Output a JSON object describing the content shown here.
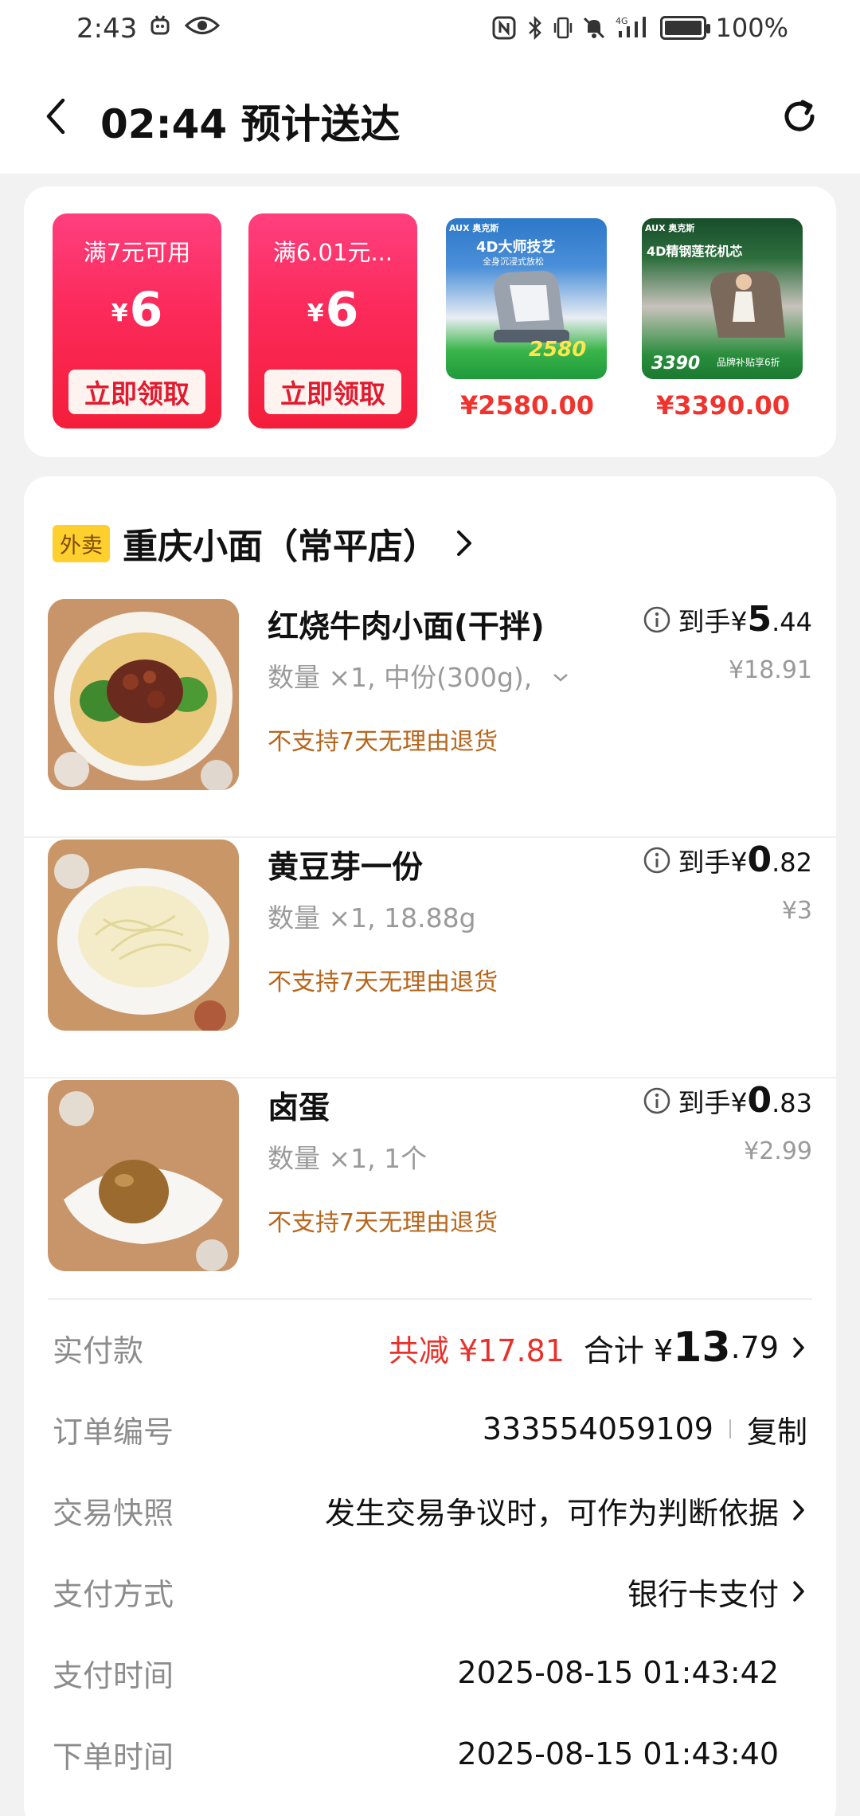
{
  "status": {
    "time": "2:43",
    "battery": "100%"
  },
  "header": {
    "title": "02:44 预计送达"
  },
  "coupons": [
    {
      "title": "满7元可用",
      "currency": "¥",
      "amount": "6",
      "button": "立即领取"
    },
    {
      "title": "满6.01元...",
      "currency": "¥",
      "amount": "6",
      "button": "立即领取"
    }
  ],
  "ads": [
    {
      "price": "¥2580.00",
      "brand": "AUX 奥克斯",
      "headline": "4D大师技艺",
      "sub": "全身沉浸式放松",
      "promo": "2580"
    },
    {
      "price": "¥3390.00",
      "brand": "AUX 奥克斯",
      "headline": "4D精钢莲花机芯",
      "sub": "品牌补贴享6折",
      "promo": "3390"
    }
  ],
  "store": {
    "tag": "外卖",
    "name": "重庆小面（常平店）"
  },
  "items": [
    {
      "name": "红烧牛肉小面(干拌)",
      "spec": "数量 ×1, 中份(300g),",
      "note": "不支持7天无理由退货",
      "price_prefix": "到手¥",
      "price_int": "5",
      "price_dec": ".44",
      "original_price": "¥18.91"
    },
    {
      "name": "黄豆芽一份",
      "spec": "数量 ×1, 18.88g",
      "note": "不支持7天无理由退货",
      "price_prefix": "到手¥",
      "price_int": "0",
      "price_dec": ".82",
      "original_price": "¥3"
    },
    {
      "name": "卤蛋",
      "spec": "数量 ×1, 1个",
      "note": "不支持7天无理由退货",
      "price_prefix": "到手¥",
      "price_int": "0",
      "price_dec": ".83",
      "original_price": "¥2.99"
    }
  ],
  "payment": {
    "paid_label": "实付款",
    "discount": "共减 ¥17.81",
    "total_prefix": "合计 ¥",
    "total_int": "13",
    "total_dec": ".79"
  },
  "details": {
    "order_no_label": "订单编号",
    "order_no": "333554059109",
    "copy": "复制",
    "snapshot_label": "交易快照",
    "snapshot_value": "发生交易争议时，可作为判断依据",
    "method_label": "支付方式",
    "method_value": "银行卡支付",
    "pay_time_label": "支付时间",
    "pay_time": "2025-08-15 01:43:42",
    "order_time_label": "下单时间",
    "order_time": "2025-08-15 01:43:40"
  }
}
